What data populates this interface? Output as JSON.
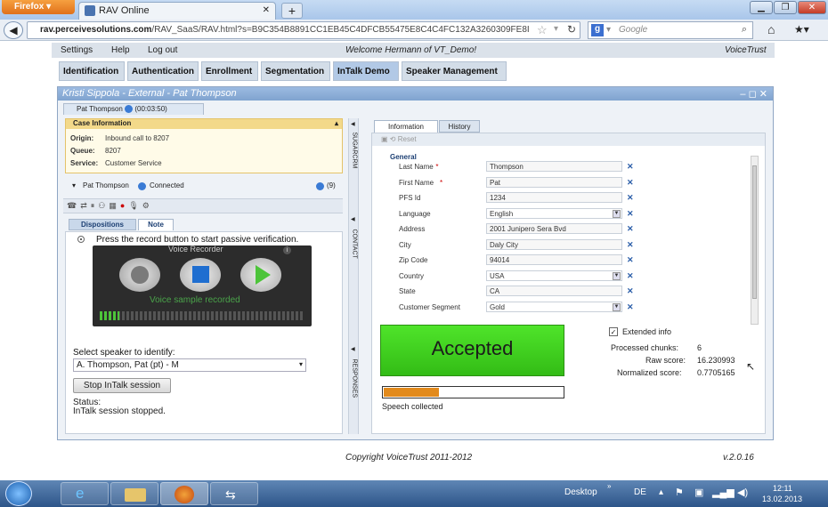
{
  "browser": {
    "app_button": "Firefox",
    "tab_title": "RAV Online",
    "url_host": "rav.perceivesolutions.com",
    "url_path": "/RAV_SaaS/RAV.html?s=B9C354B8891CC1EB45C4DFCB55475E8C4C4FC132A3260309FE8I",
    "search_placeholder": "Google"
  },
  "menu": {
    "settings": "Settings",
    "help": "Help",
    "logout": "Log out",
    "welcome": "Welcome Hermann of VT_Demo!",
    "brand": "VoiceTrust"
  },
  "nav_tabs": [
    "Identification",
    "Authentication",
    "Enrollment",
    "Segmentation",
    "InTalk Demo",
    "Speaker Management"
  ],
  "panel": {
    "title": "Kristi Sippola - External - Pat Thompson",
    "call_tab_name": "Pat Thompson",
    "call_tab_time": "(00:03:50)",
    "case_header": "Case Information",
    "origin_label": "Origin:",
    "origin_value": "Inbound call to 8207",
    "queue_label": "Queue:",
    "queue_value": "8207",
    "service_label": "Service:",
    "service_value": "Customer Service",
    "caller_name": "Pat Thompson",
    "caller_status": "Connected",
    "caller_count": "(9)",
    "sub_tabs": [
      "Dispositions",
      "Note"
    ],
    "side_labels": [
      "SUGARCRM",
      "CONTACT",
      "RESPONSES"
    ],
    "instruction": "Press the record button to start passive verification.",
    "recorder_title": "Voice Recorder",
    "recorder_status": "Voice sample recorded",
    "select_label": "Select speaker to identify:",
    "select_value": "A. Thompson, Pat (pt) - M",
    "stop_button": "Stop InTalk session",
    "status_label": "Status:",
    "status_value": "InTalk session stopped."
  },
  "info": {
    "tabs": [
      "Information",
      "History"
    ],
    "reset": "Reset",
    "section": "General",
    "fields": [
      {
        "label": "Last Name",
        "value": "Thompson",
        "required": true,
        "dropdown": false
      },
      {
        "label": "First Name",
        "value": "Pat",
        "required": true,
        "dropdown": false
      },
      {
        "label": "PFS Id",
        "value": "1234",
        "required": false,
        "dropdown": false
      },
      {
        "label": "Language",
        "value": "English",
        "required": false,
        "dropdown": true
      },
      {
        "label": "Address",
        "value": "2001 Junipero Sera Bvd",
        "required": false,
        "dropdown": false
      },
      {
        "label": "City",
        "value": "Daly City",
        "required": false,
        "dropdown": false
      },
      {
        "label": "Zip Code",
        "value": "94014",
        "required": false,
        "dropdown": false
      },
      {
        "label": "Country",
        "value": "USA",
        "required": false,
        "dropdown": true
      },
      {
        "label": "State",
        "value": "CA",
        "required": false,
        "dropdown": false
      },
      {
        "label": "Customer Segment",
        "value": "Gold",
        "required": false,
        "dropdown": true
      }
    ],
    "result": "Accepted",
    "extended_label": "Extended info",
    "processed_label": "Processed chunks:",
    "processed_value": "6",
    "raw_label": "Raw score:",
    "raw_value": "16.230993",
    "norm_label": "Normalized score:",
    "norm_value": "0.7705165",
    "speech_label": "Speech collected",
    "speech_progress": 0.31
  },
  "footer": {
    "copyright": "Copyright VoiceTrust 2011-2012",
    "version": "v.2.0.16"
  },
  "taskbar": {
    "desktop": "Desktop",
    "lang": "DE",
    "time": "12:11",
    "date": "13.02.2013"
  },
  "colors": {
    "accepted": "#44d11f",
    "progress": "#e28a1c",
    "nav_active": "#b2c9e6"
  }
}
